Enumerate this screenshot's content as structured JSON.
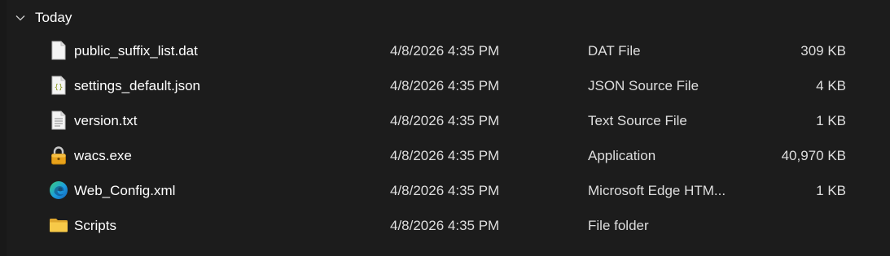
{
  "group": {
    "label": "Today",
    "chevron_icon": "chevron-down-icon"
  },
  "files": [
    {
      "name": "public_suffix_list.dat",
      "modified": "4/8/2026 4:35 PM",
      "type": "DAT File",
      "size": "309 KB",
      "icon": "blank-document-icon"
    },
    {
      "name": "settings_default.json",
      "modified": "4/8/2026 4:35 PM",
      "type": "JSON Source File",
      "size": "4 KB",
      "icon": "json-file-icon"
    },
    {
      "name": "version.txt",
      "modified": "4/8/2026 4:35 PM",
      "type": "Text Source File",
      "size": "1 KB",
      "icon": "text-file-icon"
    },
    {
      "name": "wacs.exe",
      "modified": "4/8/2026 4:35 PM",
      "type": "Application",
      "size": "40,970 KB",
      "icon": "padlock-app-icon"
    },
    {
      "name": "Web_Config.xml",
      "modified": "4/8/2026 4:35 PM",
      "type": "Microsoft Edge HTM...",
      "size": "1 KB",
      "icon": "edge-browser-icon"
    },
    {
      "name": "Scripts",
      "modified": "4/8/2026 4:35 PM",
      "type": "File folder",
      "size": "",
      "icon": "folder-icon"
    }
  ],
  "colors": {
    "background": "#1c1c1c",
    "text": "#ffffff",
    "secondary_text": "#dedede",
    "folder": "#f5c342",
    "padlock": "#e8a21a",
    "edge_blue": "#1b78d0",
    "edge_green": "#3ccf7a"
  }
}
